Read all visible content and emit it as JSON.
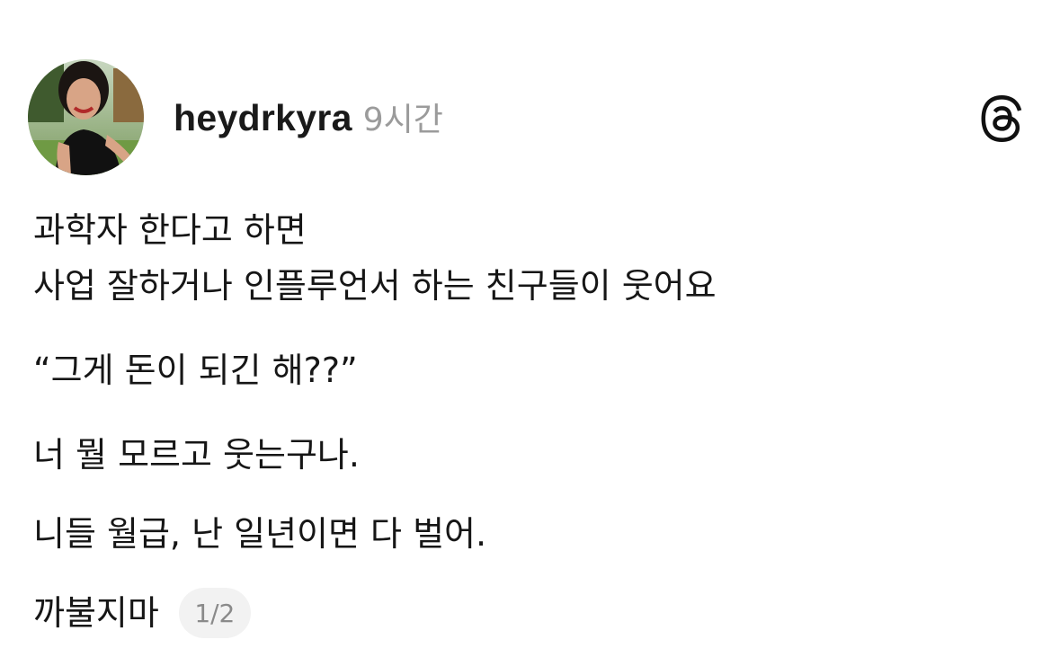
{
  "post": {
    "username": "heydrkyra",
    "time": "9시간",
    "lines": [
      "과학자 한다고 하면",
      "사업 잘하거나 인플루언서 하는 친구들이 웃어요",
      "“그게 돈이 되긴 해??”",
      "너 뭘 모르고 웃는구나.",
      "니들 월급, 난 일년이면 다 벌어.",
      "까불지마"
    ],
    "page_indicator": "1/2"
  },
  "icons": {
    "app": "threads-icon",
    "avatar": "profile-photo"
  },
  "colors": {
    "text": "#161616",
    "muted": "#9b9b9b",
    "badge_bg": "#f2f2f2"
  }
}
